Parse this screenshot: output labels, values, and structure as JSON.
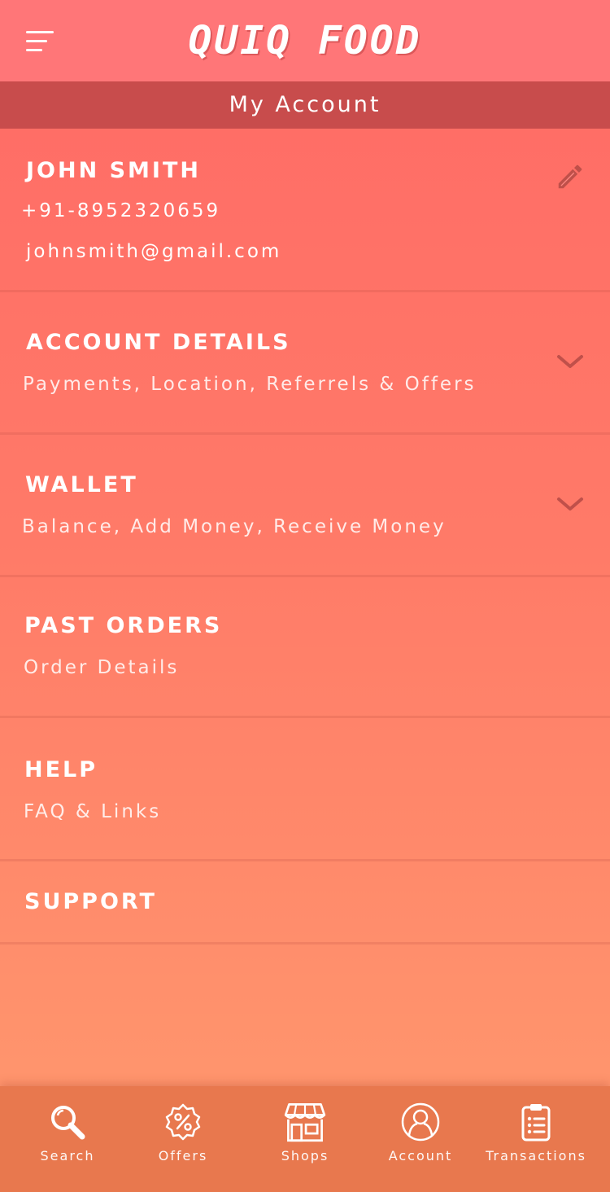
{
  "header": {
    "logo": "QUIQ FOOD",
    "title": "My Account"
  },
  "profile": {
    "name": "JOHN SMITH",
    "phone": "+91-8952320659",
    "email": "johnsmith@gmail.com"
  },
  "sections": [
    {
      "title": "ACCOUNT DETAILS",
      "subtitle": "Payments, Location, Referrels & Offers"
    },
    {
      "title": "WALLET",
      "subtitle": "Balance, Add Money, Receive Money"
    },
    {
      "title": "PAST ORDERS",
      "subtitle": "Order Details"
    },
    {
      "title": "HELP",
      "subtitle": "FAQ & Links"
    },
    {
      "title": "SUPPORT"
    }
  ],
  "nav": [
    {
      "label": "Search",
      "icon": "search-icon"
    },
    {
      "label": "Offers",
      "icon": "offer-badge-icon"
    },
    {
      "label": "Shops",
      "icon": "shop-icon"
    },
    {
      "label": "Account",
      "icon": "account-icon"
    },
    {
      "label": "Transactions",
      "icon": "clipboard-list-icon"
    }
  ],
  "colors": {
    "header": "#ff7678",
    "title_bar": "#c84c4c",
    "bottom_nav": "#e8784e",
    "accent_dark": "#c0504a"
  }
}
